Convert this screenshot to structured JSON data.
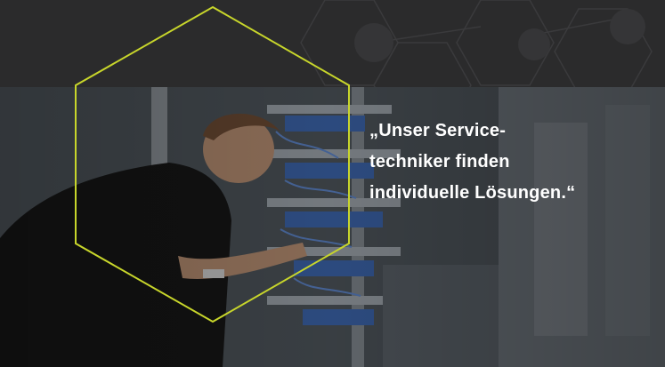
{
  "quote": {
    "lines": [
      "„Unser Service-",
      "techniker finden",
      "individuelle Lösungen.“"
    ]
  },
  "colors": {
    "accent": "#c8d62b",
    "background": "#2a2a2b",
    "text": "#ffffff"
  },
  "photo": {
    "subject": "technician-wiring-control-cabinet"
  }
}
